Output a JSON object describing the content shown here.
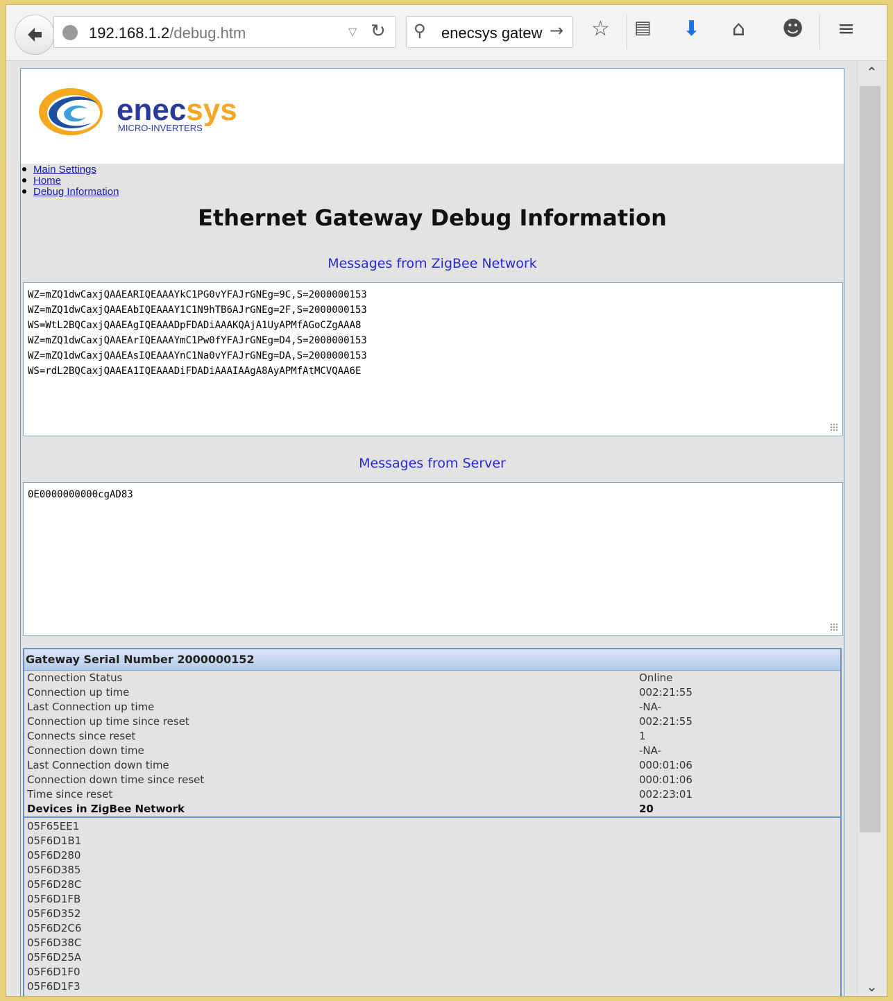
{
  "browser": {
    "url_host": "192.168.1.2",
    "url_path": "/debug.htm",
    "search_text": "enecsys gatew"
  },
  "logo": {
    "brand_main": "enec",
    "brand_accent": "sys",
    "tagline": "MICRO-INVERTERS",
    "colors": {
      "blue": "#2a3a9a",
      "orange": "#f5a623"
    }
  },
  "nav": [
    "Main Settings",
    "Home",
    "Debug Information"
  ],
  "title": "Ethernet Gateway Debug Information",
  "zigbee": {
    "label": "Messages from ZigBee Network",
    "lines": [
      "WZ=mZQ1dwCaxjQAAEARIQEAAAYkC1PG0vYFAJrGNEg=9C,S=2000000153",
      "WZ=mZQ1dwCaxjQAAEAbIQEAAAY1C1N9hTB6AJrGNEg=2F,S=2000000153",
      "WS=WtL2BQCaxjQAAEAgIQEAAADpFDADiAAAKQAjA1UyAPMfAGoCZgAAA8",
      "WZ=mZQ1dwCaxjQAAEArIQEAAAYmC1Pw0fYFAJrGNEg=D4,S=2000000153",
      "WZ=mZQ1dwCaxjQAAEAsIQEAAAYnC1Na0vYFAJrGNEg=DA,S=2000000153",
      "WS=rdL2BQCaxjQAAEA1IQEAAADiFDADiAAAIAAgA8AyAPMfAtMCVQAA6E"
    ]
  },
  "server": {
    "label": "Messages from Server",
    "lines": [
      "0E0000000000cgAD83"
    ]
  },
  "stats": {
    "header": "Gateway Serial Number 2000000152",
    "rows": [
      {
        "label": "Connection Status",
        "value": "Online"
      },
      {
        "label": "Connection up time",
        "value": "002:21:55"
      },
      {
        "label": "Last Connection up time",
        "value": "-NA-"
      },
      {
        "label": "Connection up time since reset",
        "value": "002:21:55"
      },
      {
        "label": "Connects since reset",
        "value": "1"
      },
      {
        "label": "Connection down time",
        "value": "-NA-"
      },
      {
        "label": "Last Connection down time",
        "value": "000:01:06"
      },
      {
        "label": "Connection down time since reset",
        "value": "000:01:06"
      },
      {
        "label": "Time since reset",
        "value": "002:23:01"
      },
      {
        "label": "Devices in ZigBee Network",
        "value": "20"
      }
    ],
    "devices": [
      "05F65EE1",
      "05F6D1B1",
      "05F6D280",
      "05F6D385",
      "05F6D28C",
      "05F6D1FB",
      "05F6D352",
      "05F6D2C6",
      "05F6D38C",
      "05F6D25A",
      "05F6D1F0",
      "05F6D1F3"
    ]
  }
}
